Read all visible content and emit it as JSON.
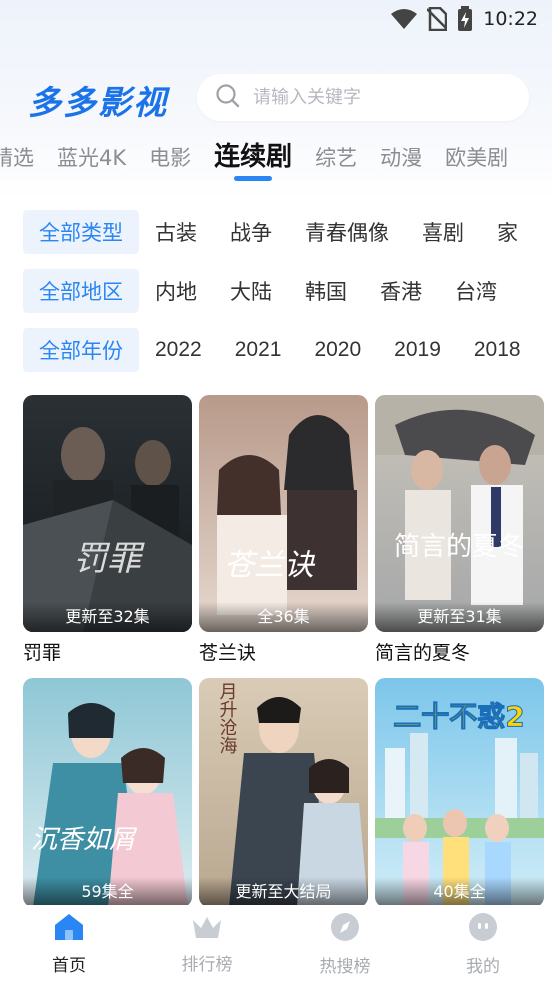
{
  "status_bar": {
    "time": "10:22"
  },
  "app": {
    "title": "多多影视"
  },
  "search": {
    "placeholder": "请输入关键字"
  },
  "tabs": [
    {
      "label": "精选"
    },
    {
      "label": "蓝光4K"
    },
    {
      "label": "电影"
    },
    {
      "label": "连续剧",
      "active": true
    },
    {
      "label": "综艺"
    },
    {
      "label": "动漫"
    },
    {
      "label": "欧美剧"
    }
  ],
  "filters": {
    "type": [
      "全部类型",
      "古装",
      "战争",
      "青春偶像",
      "喜剧",
      "家"
    ],
    "region": [
      "全部地区",
      "内地",
      "大陆",
      "韩国",
      "香港",
      "台湾"
    ],
    "year": [
      "全部年份",
      "2022",
      "2021",
      "2020",
      "2019",
      "2018"
    ]
  },
  "shows": [
    {
      "title": "罚罪",
      "badge": "更新至32集"
    },
    {
      "title": "苍兰诀",
      "badge": "全36集"
    },
    {
      "title": "简言的夏冬",
      "badge": "更新至31集"
    },
    {
      "title": "",
      "badge": "59集全"
    },
    {
      "title": "",
      "badge": "更新至大结局"
    },
    {
      "title": "",
      "badge": "40集全"
    }
  ],
  "posters": {
    "p1_text": "罚罪",
    "p2_text": "苍兰诀",
    "p3_text": "简言的夏冬",
    "p4_text": "沉香如屑",
    "p5_text": "月升沧海",
    "p6_text": "二十不惑2"
  },
  "bottom_nav": [
    {
      "label": "首页",
      "icon": "home-icon",
      "active": true
    },
    {
      "label": "排行榜",
      "icon": "crown-icon"
    },
    {
      "label": "热搜榜",
      "icon": "compass-icon"
    },
    {
      "label": "我的",
      "icon": "profile-icon"
    }
  ],
  "colors": {
    "accent": "#2a86f2",
    "logo": "#1a73e8"
  }
}
